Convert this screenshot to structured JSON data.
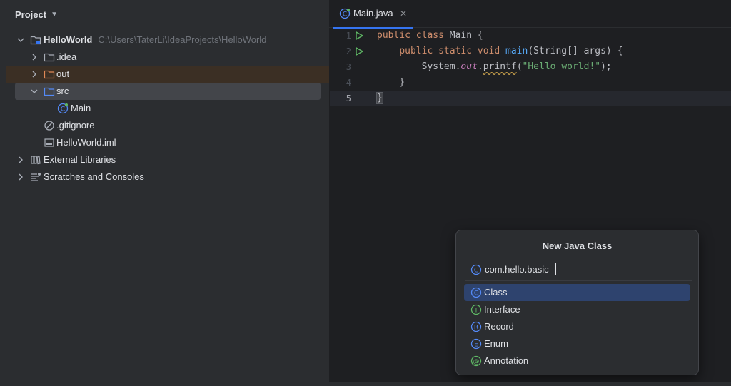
{
  "project": {
    "title": "Project",
    "tree": {
      "root_label": "HelloWorld",
      "root_path": "C:\\Users\\TaterLi\\IdeaProjects\\HelloWorld",
      "idea": ".idea",
      "out": "out",
      "src": "src",
      "main": "Main",
      "gitignore": ".gitignore",
      "iml": "HelloWorld.iml",
      "ext_libs": "External Libraries",
      "scratches": "Scratches and Consoles"
    }
  },
  "editor": {
    "tab_label": "Main.java",
    "tab_close": "✕",
    "line_numbers": [
      "1",
      "2",
      "3",
      "4",
      "5"
    ],
    "code": {
      "l1_kw": "public class ",
      "l1_name": "Main ",
      "l1_brace": "{",
      "l2_indent": "    ",
      "l2_kw": "public static void ",
      "l2_fn": "main",
      "l2_rest": "(String[] args) {",
      "l3_indent": "        ",
      "l3_sys": "System.",
      "l3_out": "out",
      "l3_dot": ".",
      "l3_fn": "printf",
      "l3_open": "(",
      "l3_str": "\"Hello world!\"",
      "l3_close": ");",
      "l4": "    }",
      "l5": "}"
    }
  },
  "dialog": {
    "title": "New Java Class",
    "input_value": "com.hello.basic",
    "options": [
      {
        "label": "Class",
        "letter": "C",
        "color": "#3574f0"
      },
      {
        "label": "Interface",
        "letter": "I",
        "color": "#5fb865"
      },
      {
        "label": "Record",
        "letter": "R",
        "color": "#3574f0"
      },
      {
        "label": "Enum",
        "letter": "E",
        "color": "#3574f0"
      },
      {
        "label": "Annotation",
        "letter": "@",
        "color": "#5fb865"
      }
    ]
  }
}
